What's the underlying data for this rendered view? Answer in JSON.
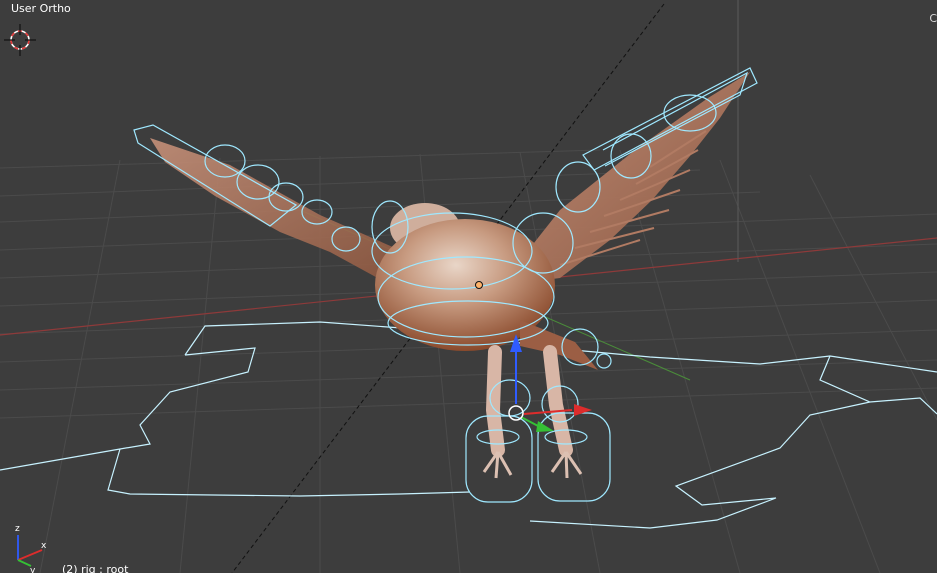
{
  "viewport": {
    "view_name": "User Ortho",
    "object_info": "(2) rig : root",
    "edge_marker": "C"
  },
  "colors": {
    "background": "#3d3d3d",
    "grid_line": "#4a4a4a",
    "x_axis": "#9b3b3b",
    "y_axis": "#4c8f3a",
    "armature_wire": "#9fe8ff",
    "bird_body": "#b57a5c",
    "gizmo_up": "#2f5cff",
    "gizmo_x": "#e03030",
    "gizmo_y": "#35c035"
  },
  "icons": [
    "3d-cursor-icon",
    "axis-gizmo-icon",
    "transform-manipulator-icon"
  ]
}
